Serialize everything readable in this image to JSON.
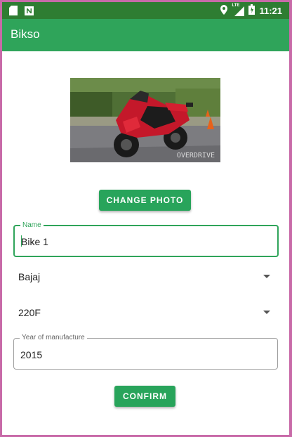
{
  "status_bar": {
    "time": "11:21",
    "network": "LTE"
  },
  "app_bar": {
    "title": "Bikso"
  },
  "photo": {
    "watermark": "OVERDRIVE"
  },
  "actions": {
    "change_photo": "CHANGE PHOTO",
    "confirm": "CONFIRM"
  },
  "form": {
    "name_label": "Name",
    "name_value": "Bike 1",
    "brand_value": "Bajaj",
    "model_value": "220F",
    "year_label": "Year of manufacture",
    "year_value": "2015"
  },
  "colors": {
    "primary": "#2fa45a",
    "primary_dark": "#2e7d32",
    "frame": "#c86aa8"
  }
}
